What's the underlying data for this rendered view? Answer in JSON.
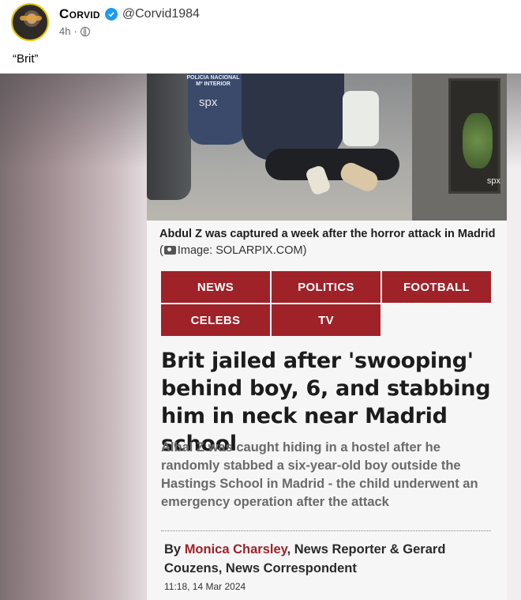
{
  "post": {
    "author_name": "Corvid",
    "handle": "@Corvid1984",
    "time": "4h",
    "separator": "·",
    "text": "“Brit”"
  },
  "article": {
    "photo_watermark_left": "spx",
    "photo_watermark_right": "spx",
    "photo_badge": "POLICIA NACIONAL\nMº INTERIOR",
    "caption": "Abdul Z was captured a week after the horror attack in Madrid",
    "caption_credit": "Image: SOLARPIX.COM",
    "nav": [
      "NEWS",
      "POLITICS",
      "FOOTBALL",
      "CELEBS",
      "TV"
    ],
    "headline": "Brit jailed after 'swooping' behind boy, 6, and stabbing him in neck near Madrid school",
    "standfirst": "Albal Z was caught hiding in a hostel after he randomly stabbed a six-year-old boy outside the Hastings School in Madrid - the child underwent an emergency operation after the attack",
    "byline_prefix": "By ",
    "byline_author": "Monica Charsley",
    "byline_rest": ", News Reporter &  Gerard Couzens, News Correspondent",
    "timestamp": "11:18, 14 Mar 2024"
  },
  "colors": {
    "accent": "#9e2228",
    "verified": "#1d9bf0",
    "avatar_ring": "#e7c500"
  },
  "icons": [
    "verified-badge-icon",
    "globe-icon",
    "camera-icon"
  ]
}
